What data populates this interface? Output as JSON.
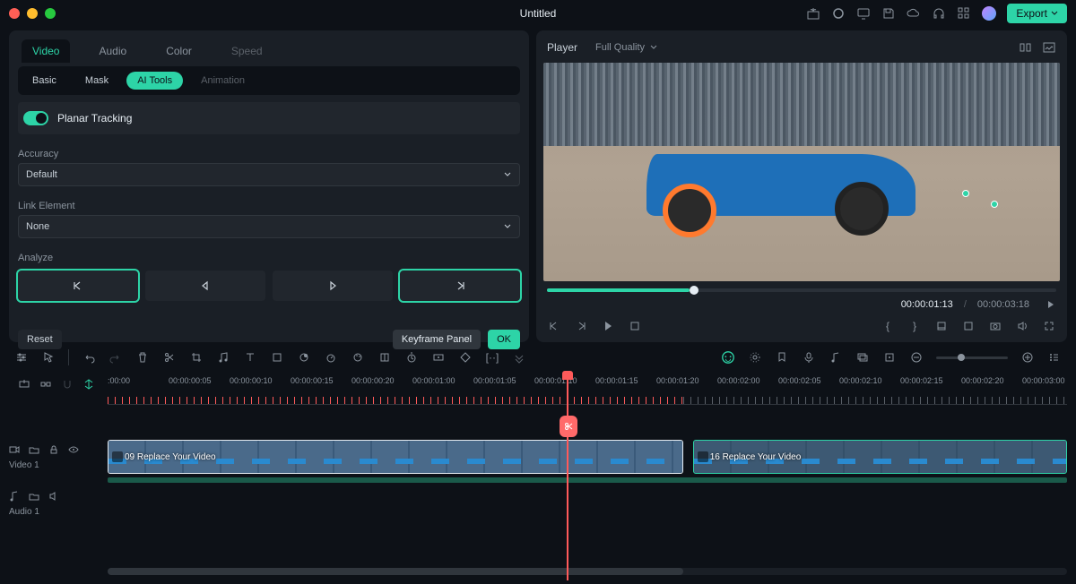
{
  "titlebar": {
    "title": "Untitled",
    "export": "Export"
  },
  "tabs_main": [
    "Video",
    "Audio",
    "Color",
    "Speed"
  ],
  "tabs_sub": [
    "Basic",
    "Mask",
    "AI Tools",
    "Animation"
  ],
  "planar": {
    "label": "Planar Tracking",
    "accuracy_label": "Accuracy",
    "accuracy_value": "Default",
    "link_label": "Link Element",
    "link_value": "None",
    "analyze_label": "Analyze"
  },
  "footer": {
    "reset": "Reset",
    "keyframe": "Keyframe Panel",
    "ok": "OK"
  },
  "player": {
    "label": "Player",
    "quality": "Full Quality",
    "time_current": "00:00:01:13",
    "time_total": "00:00:03:18"
  },
  "ruler": [
    ":00:00",
    "00:00:00:05",
    "00:00:00:10",
    "00:00:00:15",
    "00:00:00:20",
    "00:00:01:00",
    "00:00:01:05",
    "00:00:01:10",
    "00:00:01:15",
    "00:00:01:20",
    "00:00:02:00",
    "00:00:02:05",
    "00:00:02:10",
    "00:00:02:15",
    "00:00:02:20",
    "00:00:03:00"
  ],
  "tracks": {
    "video": {
      "name": "Video 1",
      "clip1": "09 Replace Your Video",
      "clip2": "16 Replace Your Video"
    },
    "audio": {
      "name": "Audio 1"
    }
  }
}
